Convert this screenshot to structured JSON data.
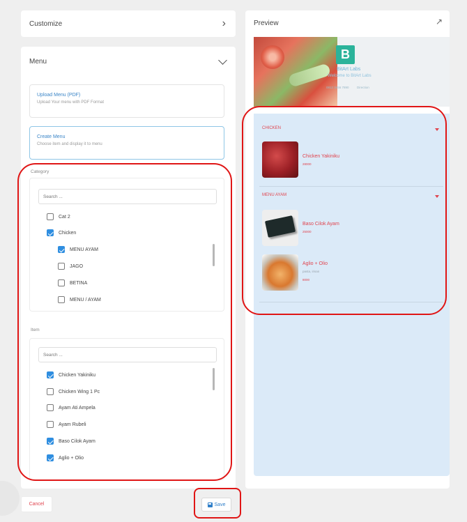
{
  "customize": {
    "title": "Customize",
    "chevron": "chevron-right-icon"
  },
  "menu": {
    "title": "Menu",
    "chevron": "chevron-down-icon",
    "options": [
      {
        "title": "Upload Menu (PDF)",
        "desc": "Upload Your menu with PDF Format"
      },
      {
        "title": "Create Menu",
        "desc": "Choose item and display it to menu"
      }
    ],
    "category": {
      "label": "Category",
      "search_placeholder": "Search ...",
      "items": [
        {
          "label": "Cat 2",
          "checked": false
        },
        {
          "label": "Chicken",
          "checked": true
        },
        {
          "label": "MENU AYAM",
          "checked": true
        },
        {
          "label": "JAGO",
          "checked": false
        },
        {
          "label": "BETINA",
          "checked": false
        },
        {
          "label": "MENU / AYAM",
          "checked": false
        }
      ]
    },
    "item": {
      "label": "Item",
      "search_placeholder": "Search ...",
      "items": [
        {
          "label": "Chicken Yakiniku",
          "checked": true
        },
        {
          "label": "Chicken Wing 1 Pc",
          "checked": false
        },
        {
          "label": "Ayam Ati Ampela",
          "checked": false
        },
        {
          "label": "Ayam Rubeli",
          "checked": false
        },
        {
          "label": "Baso Cilok Ayam",
          "checked": true
        },
        {
          "label": "Aglio + Olio",
          "checked": true
        }
      ]
    }
  },
  "preview": {
    "title": "Preview",
    "external_icon": "external-link-icon",
    "banner": {
      "logo_letter": "B",
      "brand": "BitArt Labs",
      "welcome": "Welcome to BitArt Labs",
      "link_a": "0812 3456 7890",
      "link_b": "Direction"
    },
    "categories": [
      {
        "title": "CHICKEN",
        "items": [
          {
            "name": "Chicken Yakiniku",
            "desc": "",
            "price": "28000"
          }
        ]
      },
      {
        "title": "MENU AYAM",
        "items": [
          {
            "name": "Baso Cilok Ayam",
            "desc": "",
            "price": "25000"
          },
          {
            "name": "Aglio + Olio",
            "desc": "pasta, irisan ",
            "price": "8000"
          }
        ]
      }
    ]
  },
  "footer": {
    "cancel_label": "Cancel",
    "save_label": "Save"
  },
  "colors": {
    "accent_red": "#e0444e",
    "accent_blue": "#2f8ee0",
    "highlight": "#e01515",
    "preview_bg": "#dbeaf8"
  }
}
